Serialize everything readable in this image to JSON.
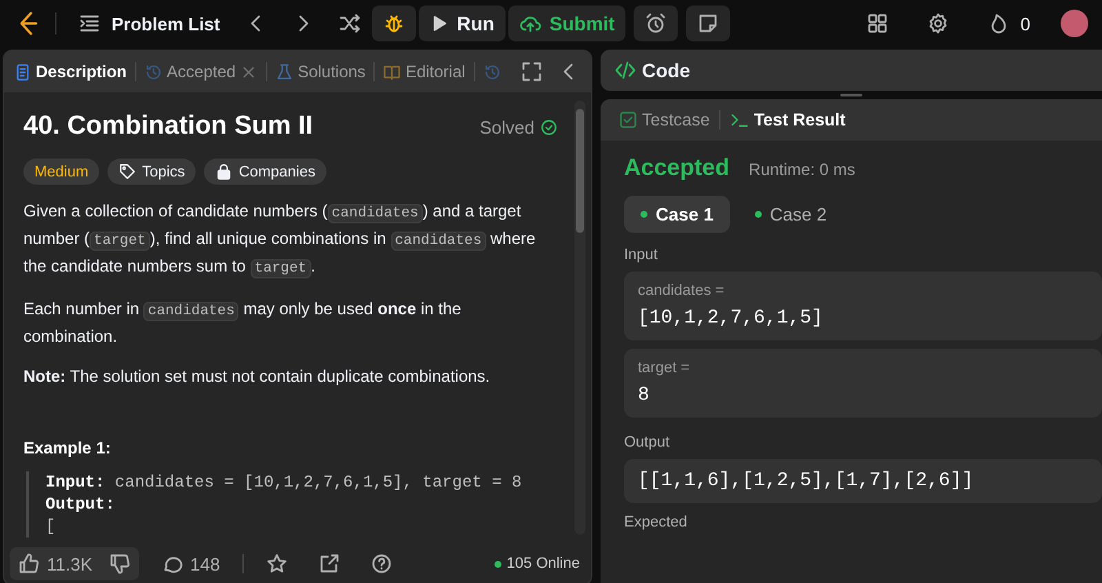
{
  "top_bar": {
    "problem_list": "Problem List",
    "run": "Run",
    "submit": "Submit",
    "streak": "0"
  },
  "description_tabs": [
    {
      "kind": "description",
      "label": "Description",
      "selected": true
    },
    {
      "kind": "accepted",
      "label": "Accepted",
      "selected": false
    },
    {
      "kind": "solutions",
      "label": "Solutions",
      "selected": false
    },
    {
      "kind": "editorial",
      "label": "Editorial",
      "selected": false
    },
    {
      "kind": "history",
      "selected": false
    }
  ],
  "problem": {
    "title": "40. Combination Sum II",
    "status": "Solved",
    "difficulty": "Medium",
    "tags": [
      {
        "kind": "topics",
        "label": "Topics"
      },
      {
        "kind": "companies",
        "label": "Companies"
      }
    ],
    "paragraphs": [
      [
        {
          "kind": "text",
          "text": "Given a collection of candidate numbers ("
        },
        {
          "kind": "code",
          "text": "candidates"
        },
        {
          "kind": "text",
          "text": ") and a target number ("
        },
        {
          "kind": "code",
          "text": "target"
        },
        {
          "kind": "text",
          "text": "), find all unique combinations in "
        },
        {
          "kind": "code",
          "text": "candidates"
        },
        {
          "kind": "text",
          "text": " where the candidate numbers sum to "
        },
        {
          "kind": "code",
          "text": "target"
        },
        {
          "kind": "text",
          "text": "."
        }
      ],
      [
        {
          "kind": "text",
          "text": "Each number in "
        },
        {
          "kind": "code",
          "text": "candidates"
        },
        {
          "kind": "text",
          "text": " may only be used "
        },
        {
          "kind": "bold",
          "text": "once"
        },
        {
          "kind": "text",
          "text": " in the combination."
        }
      ],
      [
        {
          "kind": "bold",
          "text": "Note:"
        },
        {
          "kind": "text",
          "text": " The solution set must not contain duplicate combinations."
        }
      ]
    ],
    "example_heading": "Example 1:",
    "example_lines": [
      [
        {
          "kind": "bold",
          "text": "Input:"
        },
        {
          "kind": "text",
          "text": " candidates = [10,1,2,7,6,1,5], target = 8"
        }
      ],
      [
        {
          "kind": "bold",
          "text": "Output:"
        }
      ],
      [
        {
          "kind": "text",
          "text": "["
        }
      ]
    ]
  },
  "footer": {
    "likes": "11.3K",
    "comments": "148",
    "online": "105 Online"
  },
  "code_panel": {
    "title": "Code"
  },
  "result_tabs": [
    {
      "kind": "testcase",
      "label": "Testcase",
      "selected": false
    },
    {
      "kind": "result",
      "label": "Test Result",
      "selected": true
    }
  ],
  "result": {
    "verdict": "Accepted",
    "runtime": "Runtime: 0 ms",
    "cases": [
      {
        "label": "Case 1",
        "selected": true
      },
      {
        "label": "Case 2",
        "selected": false
      }
    ],
    "input_label": "Input",
    "inputs": [
      {
        "name": "candidates =",
        "value": "[10,1,2,7,6,1,5]"
      },
      {
        "name": "target =",
        "value": "8"
      }
    ],
    "output_label": "Output",
    "output": "[[1,1,6],[1,2,5],[1,7],[2,6]]",
    "expected_label": "Expected"
  }
}
